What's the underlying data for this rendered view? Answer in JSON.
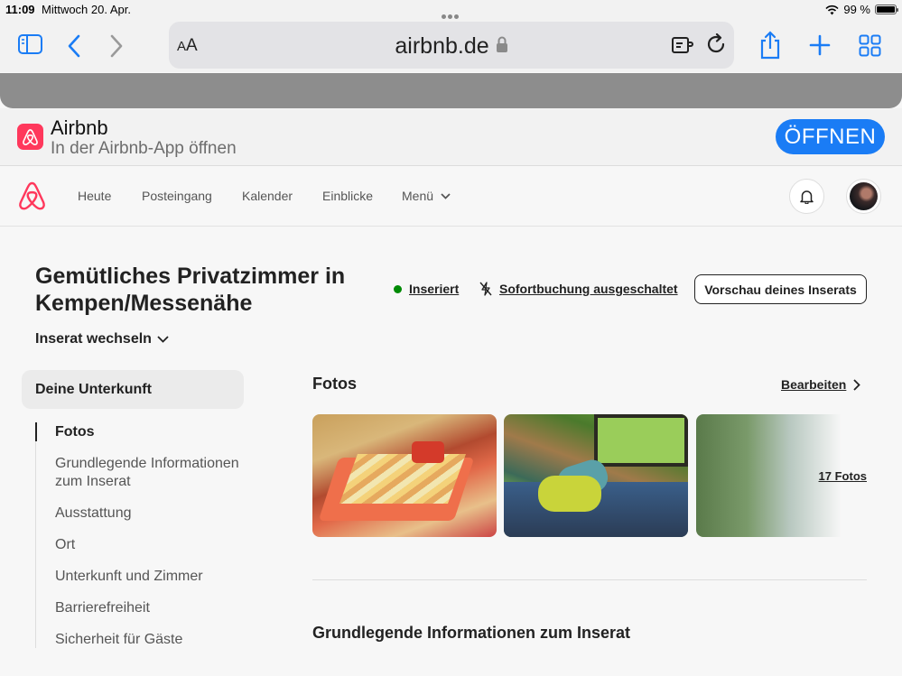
{
  "statusbar": {
    "time": "11:09",
    "date": "Mittwoch 20. Apr.",
    "battery": "99 %"
  },
  "browser": {
    "aa_small": "A",
    "aa_big": "A",
    "domain": "airbnb.de"
  },
  "banner": {
    "title": "Airbnb",
    "subtitle": "In der Airbnb-App öffnen",
    "open_label": "ÖFFNEN"
  },
  "nav": {
    "items": [
      "Heute",
      "Posteingang",
      "Kalender",
      "Einblicke",
      "Menü"
    ]
  },
  "listing": {
    "title": "Gemütliches Privatzimmer in Kempen/Messenähe",
    "status": "Inseriert",
    "instant_booking": "Sofortbuchung ausgeschaltet",
    "preview_label": "Vorschau deines Inserats",
    "switch_label": "Inserat wechseln"
  },
  "sidebar": {
    "heading": "Deine Unterkunft",
    "items": [
      "Fotos",
      "Grundlegende Informationen zum Inserat",
      "Ausstattung",
      "Ort",
      "Unterkunft und Zimmer",
      "Barrierefreiheit",
      "Sicherheit für Gäste"
    ]
  },
  "photos": {
    "title": "Fotos",
    "edit_label": "Bearbeiten",
    "count_label": "17 Fotos"
  },
  "section2": {
    "title": "Grundlegende Informationen zum Inserat"
  },
  "colors": {
    "brand": "#ff385c",
    "ios_blue": "#1a7cf5",
    "status_green": "#008a05"
  }
}
